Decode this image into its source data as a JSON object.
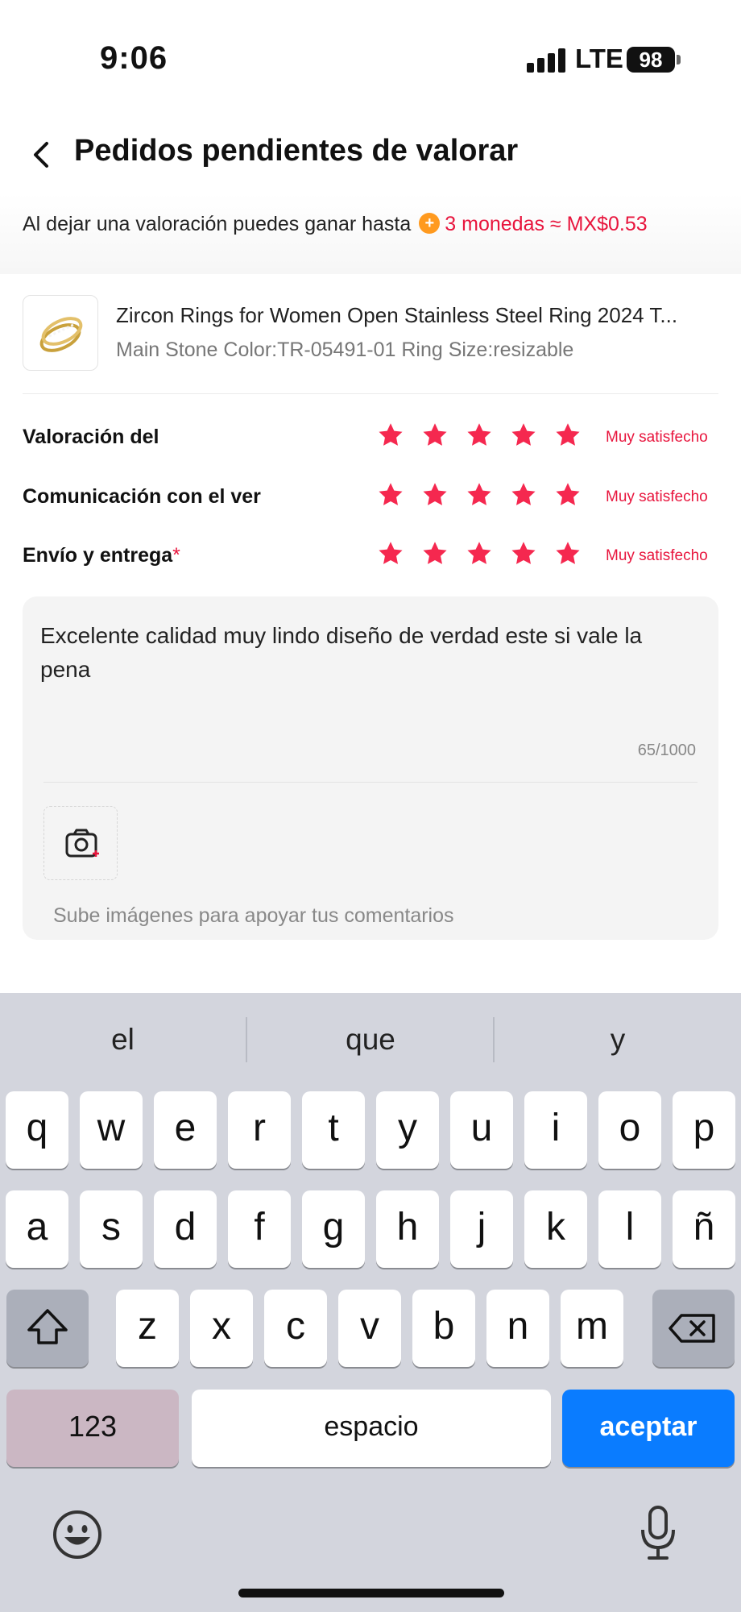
{
  "status_bar": {
    "time": "9:06",
    "network": "LTE",
    "battery": "98"
  },
  "header": {
    "title": "Pedidos pendientes de valorar"
  },
  "banner": {
    "text": "Al dejar una valoración puedes ganar hasta",
    "coins": "3 monedas ≈ MX$0.53",
    "coin_icon": "coin-plus-icon",
    "accent_color": "#e8153d"
  },
  "product": {
    "title": "Zircon Rings for Women Open Stainless Steel Ring 2024 T...",
    "variant": "Main Stone Color:TR-05491-01 Ring Size:resizable",
    "thumbnail_icon": "gold-ring-image"
  },
  "ratings": [
    {
      "label": "Valoración del",
      "required": "",
      "stars": 5,
      "max_stars": 5,
      "text": "Muy satisfecho"
    },
    {
      "label": "Comunicación con el ver",
      "required": "",
      "stars": 5,
      "max_stars": 5,
      "text": "Muy satisfecho"
    },
    {
      "label": "Envío y entrega",
      "required": "*",
      "stars": 5,
      "max_stars": 5,
      "text": "Muy satisfecho"
    }
  ],
  "comment": {
    "text": "Excelente calidad muy lindo diseño de verdad este si vale la pena",
    "counter": "65/1000",
    "upload_icon": "camera-plus-icon",
    "upload_hint": "Sube imágenes para apoyar tus comentarios"
  },
  "keyboard": {
    "suggestions": [
      "el",
      "que",
      "y"
    ],
    "row1": [
      "q",
      "w",
      "e",
      "r",
      "t",
      "y",
      "u",
      "i",
      "o",
      "p"
    ],
    "row2": [
      "a",
      "s",
      "d",
      "f",
      "g",
      "h",
      "j",
      "k",
      "l",
      "ñ"
    ],
    "row3": [
      "z",
      "x",
      "c",
      "v",
      "b",
      "n",
      "m"
    ],
    "shift_icon": "shift-icon",
    "delete_icon": "backspace-icon",
    "numbers_label": "123",
    "space_label": "espacio",
    "return_label": "aceptar",
    "emoji_icon": "emoji-icon",
    "mic_icon": "microphone-icon",
    "return_color": "#0a7cff"
  }
}
